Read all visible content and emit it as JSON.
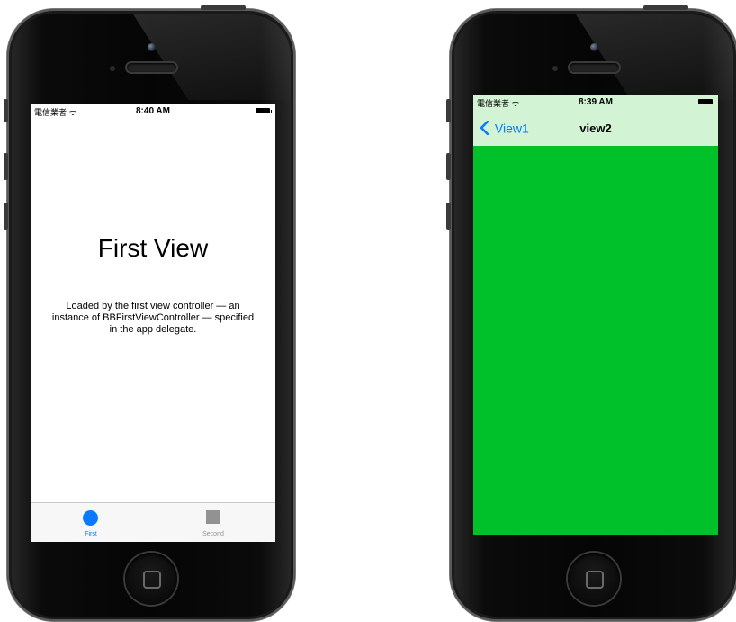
{
  "left_phone": {
    "status": {
      "carrier": "電信業者 ᯤ",
      "time": "8:40 AM"
    },
    "title": "First View",
    "description": "Loaded by the first view controller — an instance of BBFirstViewController — specified in the app delegate.",
    "tabs": [
      {
        "label": "First",
        "icon": "circle-icon",
        "selected": true
      },
      {
        "label": "Second",
        "icon": "square-icon",
        "selected": false
      }
    ]
  },
  "right_phone": {
    "status": {
      "carrier": "電信業者 ᯤ",
      "time": "8:39 AM"
    },
    "nav": {
      "back_label": "View1",
      "title": "view2"
    },
    "colors": {
      "nav_bar": "#d2f3d4",
      "content": "#00c12a"
    }
  },
  "colors": {
    "accent": "#0a7aff",
    "inactive": "#929292"
  }
}
